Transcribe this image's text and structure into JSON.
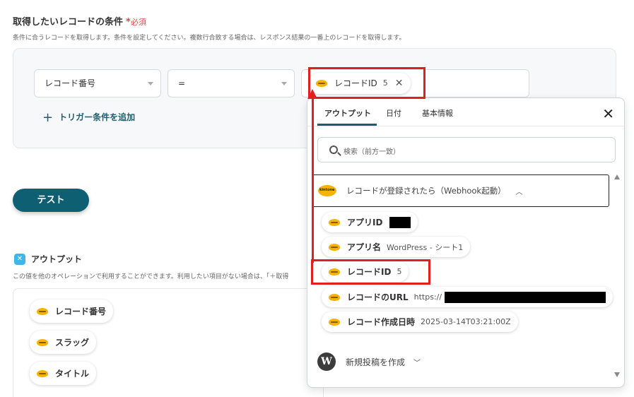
{
  "condition": {
    "title": "取得したいレコードの条件",
    "required_star": "*",
    "required_text": "必須",
    "description": "条件に合うレコードを取得します。条件を設定してください。複数行合致する場合は、レスポンス結果の一番上のレコードを取得します。",
    "field_value": "レコード番号",
    "operator_value": "=",
    "value_chip": {
      "label": "レコードID",
      "value": "5"
    },
    "add_trigger_label": "トリガー条件を追加"
  },
  "test_button_label": "テスト",
  "output": {
    "title": "アウトプット",
    "description": "この値を他のオペレーションで利用することができます。利用したい項目がない場合は、「＋取得",
    "items": [
      "レコード番号",
      "スラッグ",
      "タイトル"
    ]
  },
  "panel": {
    "tabs": [
      "アウトプット",
      "日付",
      "基本情報"
    ],
    "search_placeholder": "検索（前方一致）",
    "group_label": "レコードが登録されたら（Webhook起動）",
    "items": [
      {
        "name": "アプリID",
        "value": ""
      },
      {
        "name": "アプリ名",
        "value": "WordPress - シート1"
      },
      {
        "name": "レコードID",
        "value": "5"
      },
      {
        "name": "レコードのURL",
        "value": "https://"
      },
      {
        "name": "レコード作成日時",
        "value": "2025-03-14T03:21:00Z"
      }
    ],
    "secondary_group_label": "新規投稿を作成"
  },
  "colors": {
    "primary": "#0f5f73",
    "annotation": "#e02020",
    "required": "#e0464e",
    "kintone": "#f5b300"
  }
}
